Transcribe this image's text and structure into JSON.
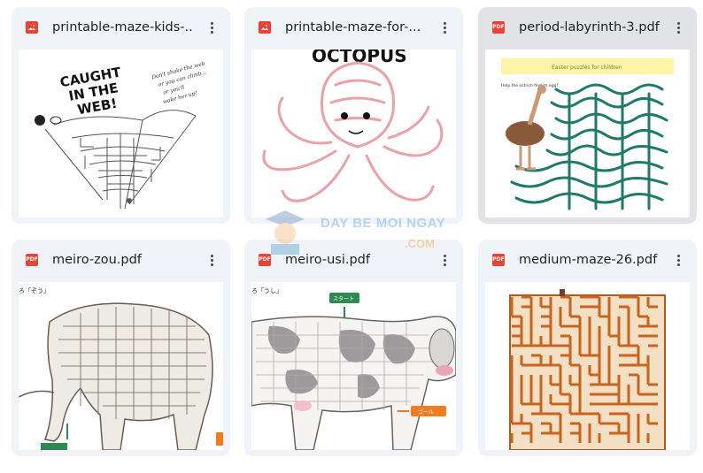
{
  "files": [
    {
      "name": "printable-maze-kids-...",
      "icon": "image-icon",
      "thumb_text": [
        "CAUGHT",
        "IN THE",
        "WEB!"
      ],
      "note": [
        "Don't shake the web",
        "or you can climb...",
        "or you'll",
        "wake her up!"
      ]
    },
    {
      "name": "printable-maze-for-...",
      "icon": "image-icon",
      "thumb_text": [
        "OCTOPUS"
      ]
    },
    {
      "name": "period-labyrinth-3.pdf",
      "icon": "pdf-icon",
      "thumb_title": "Easter puzzles for children",
      "thumb_caption": "Help the ostrich find its egg!"
    },
    {
      "name": "meiro-zou.pdf",
      "icon": "pdf-icon",
      "thumb_label": "ろ「ぞう」"
    },
    {
      "name": "meiro-usi.pdf",
      "icon": "pdf-icon",
      "thumb_label": "ろ「うし」",
      "start_label": "スタート",
      "goal_label": "ゴール"
    },
    {
      "name": "medium-maze-26.pdf",
      "icon": "pdf-icon"
    }
  ],
  "watermark": {
    "line1": "DAY BE MOI NGAY",
    "line2": ".COM"
  },
  "colors": {
    "card_bg": "#f0f4f9",
    "selected_bg": "#e1e3e6",
    "pdf_red": "#ea4335",
    "maze_teal": "#1f7a6a",
    "maze_orange": "#c8641e"
  }
}
